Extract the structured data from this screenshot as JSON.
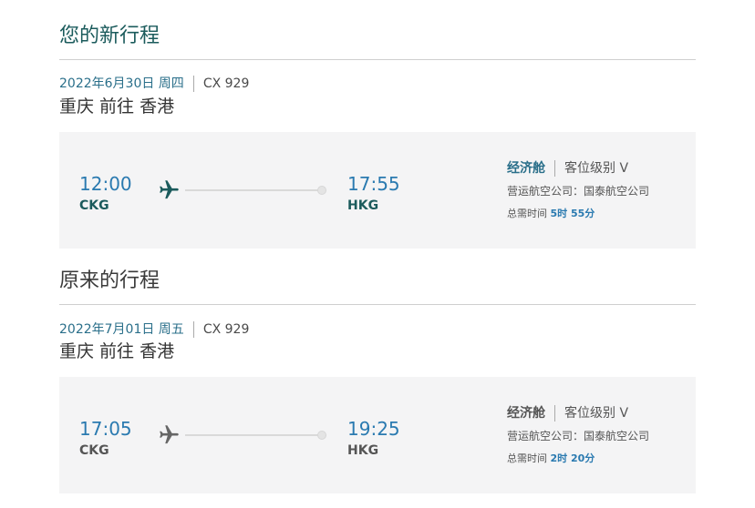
{
  "new_itinerary": {
    "heading": "您的新行程",
    "date": "2022年6月30日 周四",
    "flight": "CX 929",
    "route": "重庆 前往 香港",
    "depart_time": "12:00",
    "depart_code": "CKG",
    "arrive_time": "17:55",
    "arrive_code": "HKG",
    "cabin": "经济舱",
    "booking_class": "客位级别 V",
    "operated_by": "营运航空公司：国泰航空公司",
    "duration_label": "总需时间",
    "duration_value": "5时 55分"
  },
  "original_itinerary": {
    "heading": "原来的行程",
    "date": "2022年7月01日 周五",
    "flight": "CX 929",
    "route": "重庆 前往 香港",
    "depart_time": "17:05",
    "depart_code": "CKG",
    "arrive_time": "19:25",
    "arrive_code": "HKG",
    "cabin": "经济舱",
    "booking_class": "客位级别 V",
    "operated_by": "营运航空公司：国泰航空公司",
    "duration_label": "总需时间",
    "duration_value": "2时 20分"
  },
  "icons": {
    "new_plane": "airplane-icon",
    "orig_plane": "airplane-icon"
  },
  "colors": {
    "accent_teal": "#1b5b5c",
    "accent_blue": "#2a7ab0",
    "card_bg": "#f4f4f5"
  }
}
